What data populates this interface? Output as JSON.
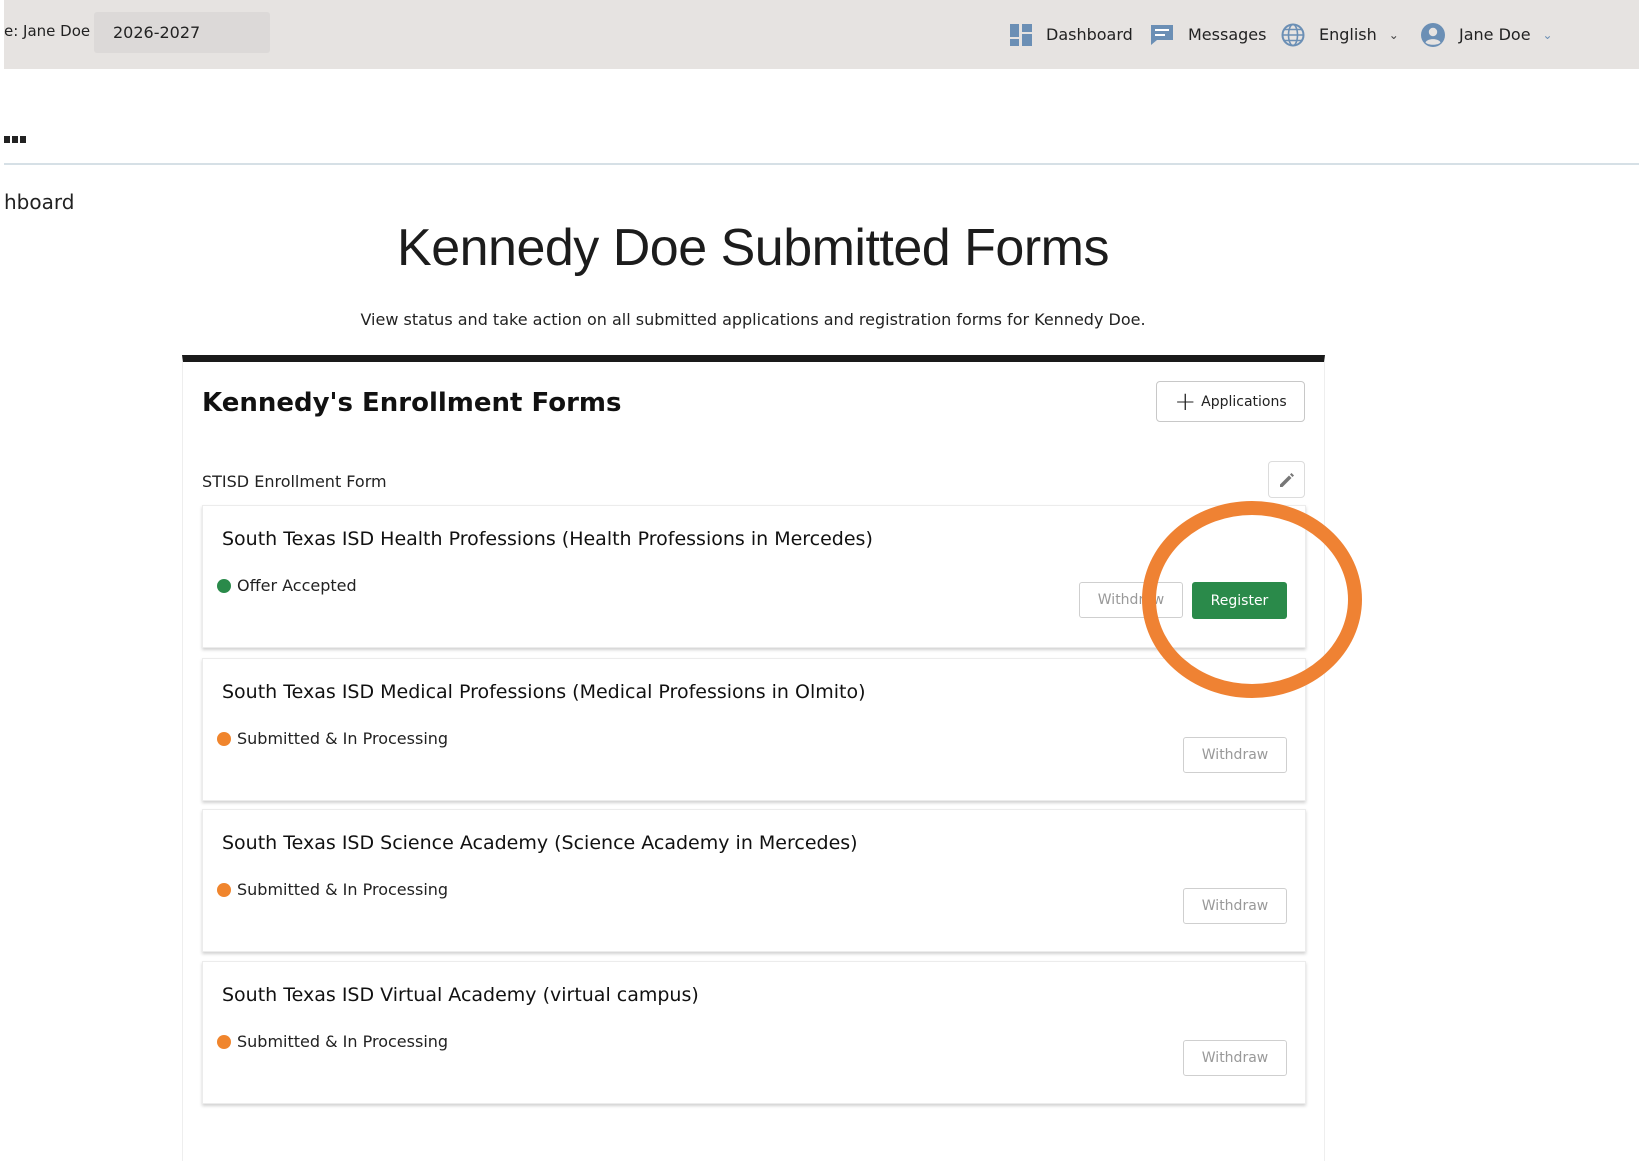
{
  "topbar": {
    "user_prefix": "e: Jane Doe",
    "year": "2026-2027",
    "dashboard_label": "Dashboard",
    "messages_label": "Messages",
    "language_label": "English",
    "user_label": "Jane Doe"
  },
  "breadcrumb": {
    "label": "hboard"
  },
  "page": {
    "title": "Kennedy Doe Submitted Forms",
    "subtitle": "View status and take action on all submitted applications and registration forms for Kennedy Doe."
  },
  "card": {
    "title": "Kennedy's Enrollment Forms",
    "applications_button": "Applications",
    "form_label": "STISD Enrollment Form"
  },
  "rows": [
    {
      "title": "South Texas ISD Health Professions (Health Professions in Mercedes)",
      "status": "Offer Accepted",
      "status_color": "#2a8a4a",
      "withdraw_label": "Withdraw",
      "register_label": "Register"
    },
    {
      "title": "South Texas ISD Medical Professions (Medical Professions in Olmito)",
      "status": "Submitted & In Processing",
      "status_color": "#f0852d",
      "withdraw_label": "Withdraw"
    },
    {
      "title": "South Texas ISD Science Academy (Science Academy in Mercedes)",
      "status": "Submitted & In Processing",
      "status_color": "#f0852d",
      "withdraw_label": "Withdraw"
    },
    {
      "title": "South Texas ISD Virtual Academy (virtual campus)",
      "status": "Submitted & In Processing",
      "status_color": "#f0852d",
      "withdraw_label": "Withdraw"
    }
  ],
  "colors": {
    "accent_green": "#2a8a4a",
    "status_orange": "#f0852d",
    "highlight_ring": "#ef8233"
  }
}
